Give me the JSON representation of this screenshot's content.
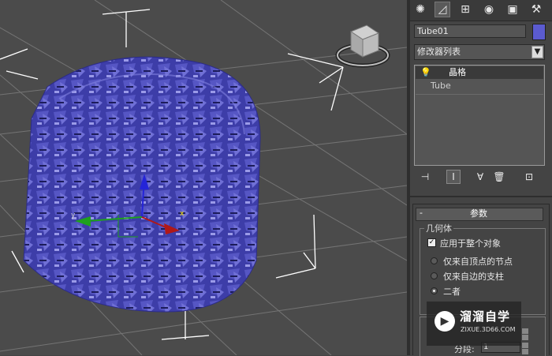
{
  "panel": {
    "tabs": [
      {
        "icon": "sun-icon",
        "glyph": "✺"
      },
      {
        "icon": "curve-icon",
        "glyph": "◿"
      },
      {
        "icon": "hierarchy-icon",
        "glyph": "⊞"
      },
      {
        "icon": "motion-icon",
        "glyph": "◉"
      },
      {
        "icon": "display-icon",
        "glyph": "▣"
      },
      {
        "icon": "hammer-icon",
        "glyph": "⚒"
      }
    ],
    "object_name": "Tube01",
    "object_color": "#5b5bd0",
    "modifier_list": "修改器列表",
    "stack": {
      "selected": "晶格",
      "base": "Tube"
    },
    "tools": [
      {
        "icon": "pin-stack-icon",
        "glyph": "⊣"
      },
      {
        "icon": "show-end-result-icon",
        "glyph": "Ⅰ"
      },
      {
        "icon": "make-unique-icon",
        "glyph": "∀"
      },
      {
        "icon": "remove-modifier-icon",
        "glyph": "🗑"
      },
      {
        "icon": "configure-modifier-sets-icon",
        "glyph": "⊡"
      }
    ]
  },
  "params": {
    "collapse": "-",
    "title": "参数",
    "group_title": "几何体",
    "apply_all": "应用于整个对象",
    "apply_all_checked": true,
    "options": [
      {
        "label": "仅来自顶点的节点",
        "selected": false
      },
      {
        "label": "仅来自边的支柱",
        "selected": false
      },
      {
        "label": "二者",
        "selected": true
      }
    ],
    "segments_label": "分段:",
    "segments_value": "1"
  },
  "watermark": {
    "title": "溜溜自学",
    "subtitle": "ZIXUE.3D66.COM"
  }
}
